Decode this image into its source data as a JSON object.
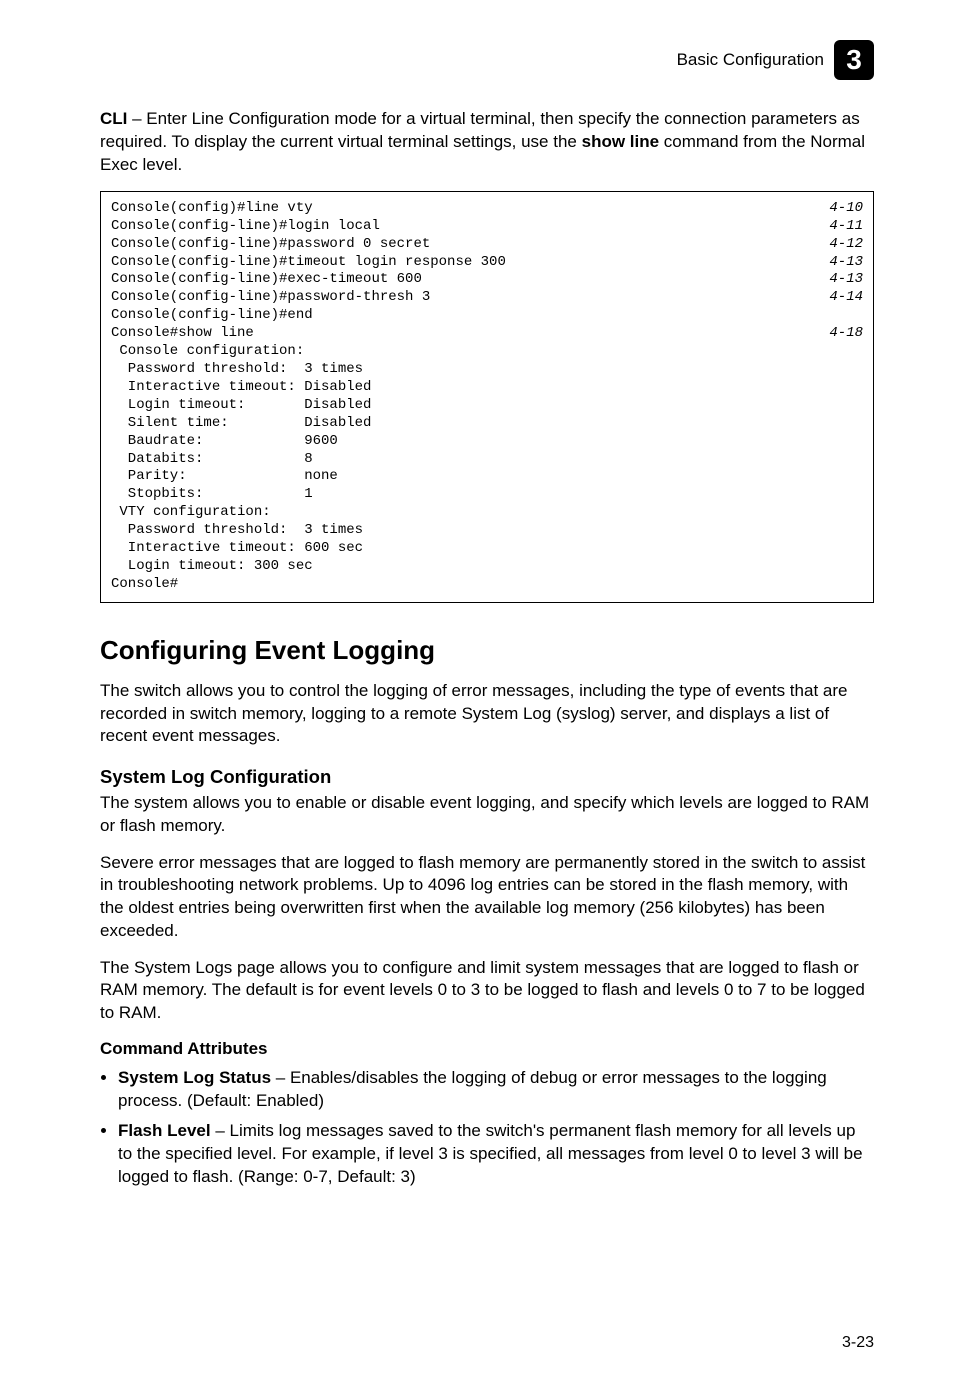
{
  "header": {
    "breadcrumb": "Basic Configuration",
    "badge": "3"
  },
  "intro": {
    "cli_label": "CLI",
    "cli_body_1": " – Enter Line Configuration mode for a virtual terminal, then specify the connection parameters as required. To display the current virtual terminal settings, use the ",
    "show_line_label": "show line",
    "cli_body_2": " command from the Normal Exec level."
  },
  "code": {
    "lines": [
      {
        "left": "Console(config)#line vty",
        "right": "4-10"
      },
      {
        "left": "Console(config-line)#login local",
        "right": "4-11"
      },
      {
        "left": "Console(config-line)#password 0 secret",
        "right": "4-12"
      },
      {
        "left": "Console(config-line)#timeout login response 300",
        "right": "4-13"
      },
      {
        "left": "Console(config-line)#exec-timeout 600",
        "right": "4-13"
      },
      {
        "left": "Console(config-line)#password-thresh 3",
        "right": "4-14"
      },
      {
        "left": "Console(config-line)#end",
        "right": ""
      },
      {
        "left": "Console#show line",
        "right": "4-18"
      },
      {
        "left": " Console configuration:",
        "right": ""
      },
      {
        "left": "  Password threshold:  3 times",
        "right": ""
      },
      {
        "left": "  Interactive timeout: Disabled",
        "right": ""
      },
      {
        "left": "  Login timeout:       Disabled",
        "right": ""
      },
      {
        "left": "  Silent time:         Disabled",
        "right": ""
      },
      {
        "left": "  Baudrate:            9600",
        "right": ""
      },
      {
        "left": "  Databits:            8",
        "right": ""
      },
      {
        "left": "  Parity:              none",
        "right": ""
      },
      {
        "left": "  Stopbits:            1",
        "right": ""
      },
      {
        "left": "",
        "right": ""
      },
      {
        "left": " VTY configuration:",
        "right": ""
      },
      {
        "left": "  Password threshold:  3 times",
        "right": ""
      },
      {
        "left": "  Interactive timeout: 600 sec",
        "right": ""
      },
      {
        "left": "  Login timeout: 300 sec",
        "right": ""
      },
      {
        "left": "Console#",
        "right": ""
      }
    ]
  },
  "section": {
    "title": "Configuring Event Logging",
    "para1": "The switch allows you to control the logging of error messages, including the type of events that are recorded in switch memory, logging to a remote System Log (syslog) server, and displays a list of recent event messages.",
    "sub_title": "System Log Configuration",
    "para2": "The system allows you to enable or disable event logging, and specify which levels are logged to RAM or flash memory.",
    "para3": "Severe error messages that are logged to flash memory are permanently stored in the switch to assist in troubleshooting network problems. Up to 4096 log entries can be stored in the flash memory, with the oldest entries being overwritten first when the available log memory (256 kilobytes) has been exceeded.",
    "para4": "The System Logs page allows you to configure and limit system messages that are logged to flash or RAM memory. The default is for event levels 0 to 3 to be logged to flash and levels 0 to 7 to be logged to RAM.",
    "attr_heading": "Command Attributes",
    "bullets": [
      {
        "bold": "System Log Status",
        "rest": " – Enables/disables the logging of debug or error messages to the logging process. (Default: Enabled)"
      },
      {
        "bold": "Flash Level",
        "rest": " – Limits log messages saved to the switch's permanent flash memory for all levels up to the specified level. For example, if level 3 is specified, all messages from level 0 to level 3 will be logged to flash. (Range: 0-7, Default: 3)"
      }
    ]
  },
  "footer": {
    "page": "3-23"
  }
}
